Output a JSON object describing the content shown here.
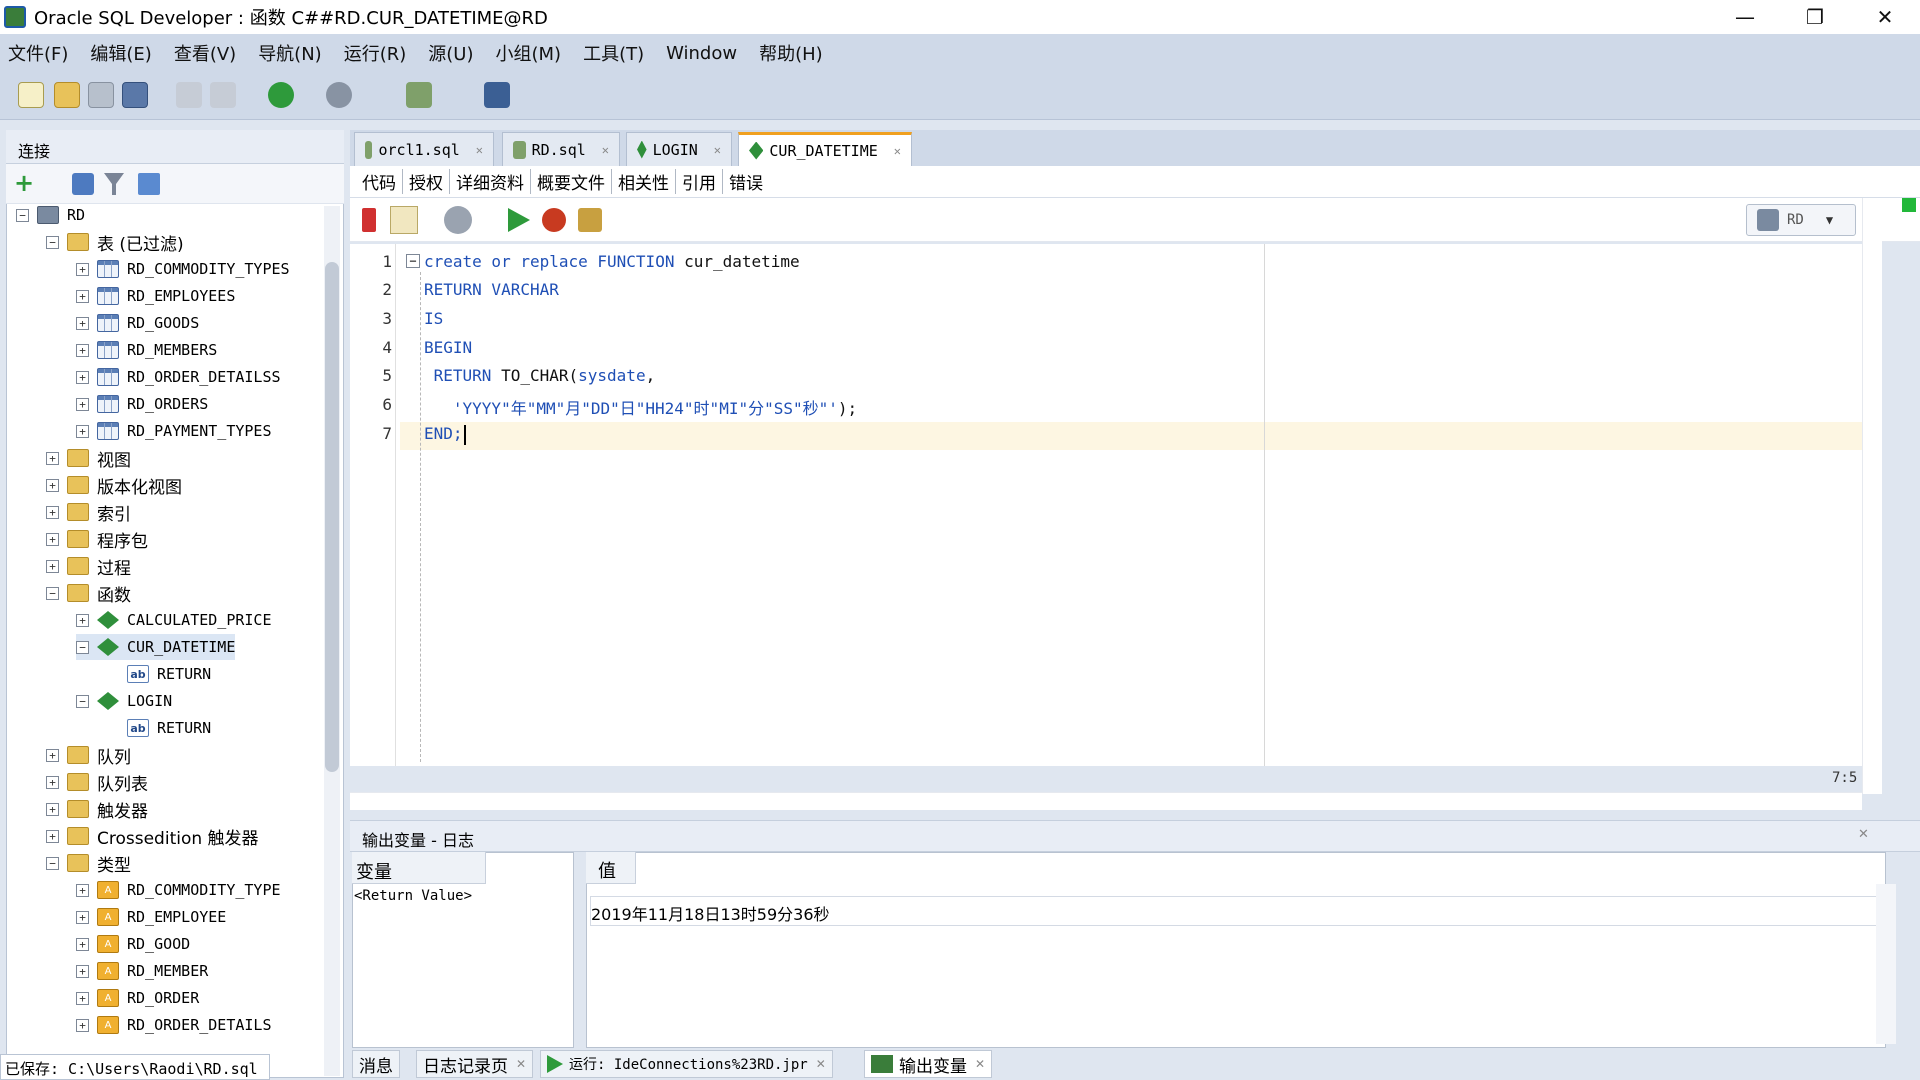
{
  "window": {
    "title": "Oracle SQL Developer : 函数 C##RD.CUR_DATETIME@RD",
    "minimize": "—",
    "restore": "❐",
    "close": "✕"
  },
  "menu": [
    "文件(F)",
    "编辑(E)",
    "查看(V)",
    "导航(N)",
    "运行(R)",
    "源(U)",
    "小组(M)",
    "工具(T)",
    "Window",
    "帮助(H)"
  ],
  "connections": {
    "title": "连接",
    "tree": [
      {
        "label": "RD",
        "mono": true,
        "expanded": true
      },
      {
        "label": "表 (已过滤)",
        "mono": false,
        "expanded": true
      },
      {
        "label": "RD_COMMODITY_TYPES",
        "mono": true
      },
      {
        "label": "RD_EMPLOYEES",
        "mono": true
      },
      {
        "label": "RD_GOODS",
        "mono": true
      },
      {
        "label": "RD_MEMBERS",
        "mono": true
      },
      {
        "label": "RD_ORDER_DETAILSS",
        "mono": true
      },
      {
        "label": "RD_ORDERS",
        "mono": true
      },
      {
        "label": "RD_PAYMENT_TYPES",
        "mono": true
      },
      {
        "label": "视图",
        "mono": false
      },
      {
        "label": "版本化视图",
        "mono": false
      },
      {
        "label": "索引",
        "mono": false
      },
      {
        "label": "程序包",
        "mono": false
      },
      {
        "label": "过程",
        "mono": false
      },
      {
        "label": "函数",
        "mono": false,
        "expanded": true
      },
      {
        "label": "CALCULATED_PRICE",
        "mono": true
      },
      {
        "label": "CUR_DATETIME",
        "mono": true,
        "selected": true,
        "expanded": true
      },
      {
        "label": "RETURN",
        "mono": true
      },
      {
        "label": "LOGIN",
        "mono": true,
        "expanded": true
      },
      {
        "label": "RETURN",
        "mono": true
      },
      {
        "label": "队列",
        "mono": false
      },
      {
        "label": "队列表",
        "mono": false
      },
      {
        "label": "触发器",
        "mono": false
      },
      {
        "label": "Crossedition 触发器",
        "mono": false
      },
      {
        "label": "类型",
        "mono": false,
        "expanded": true
      },
      {
        "label": "RD_COMMODITY_TYPE",
        "mono": true
      },
      {
        "label": "RD_EMPLOYEE",
        "mono": true
      },
      {
        "label": "RD_GOOD",
        "mono": true
      },
      {
        "label": "RD_MEMBER",
        "mono": true
      },
      {
        "label": "RD_ORDER",
        "mono": true
      },
      {
        "label": "RD_ORDER_DETAILS",
        "mono": true
      }
    ],
    "status": "已保存: C:\\Users\\Raodi\\RD.sql"
  },
  "editor": {
    "tabs": [
      "orcl1.sql",
      "RD.sql",
      "LOGIN",
      "CUR_DATETIME"
    ],
    "active_tab": "CUR_DATETIME",
    "subtabs": [
      "代码",
      "授权",
      "详细资料",
      "概要文件",
      "相关性",
      "引用",
      "错误"
    ],
    "connection": "RD",
    "line_numbers": [
      "1",
      "2",
      "3",
      "4",
      "5",
      "6",
      "7"
    ],
    "code": {
      "l1_kw": "create or replace FUNCTION",
      "l1_name": " cur_datetime",
      "l2": "RETURN VARCHAR",
      "l3": "IS",
      "l4": "BEGIN",
      "l5_kw": " RETURN",
      "l5_fn": " TO_CHAR(",
      "l5_arg": "sysdate",
      "l5_end": ",",
      "l6_str": "   'YYYY\"年\"MM\"月\"DD\"日\"HH24\"时\"MI\"分\"SS\"秒\"'",
      "l6_end": ");",
      "l7": "END;"
    },
    "cursor_pos": "7:5"
  },
  "output": {
    "title": "输出变量 - 日志",
    "var_header": "变量",
    "val_header": "值",
    "var_name": "<Return Value>",
    "value": "2019年11月18日13时59分36秒"
  },
  "bottom_tabs": [
    "消息",
    "日志记录页",
    "运行: IdeConnections%23RD.jpr",
    "输出变量"
  ]
}
